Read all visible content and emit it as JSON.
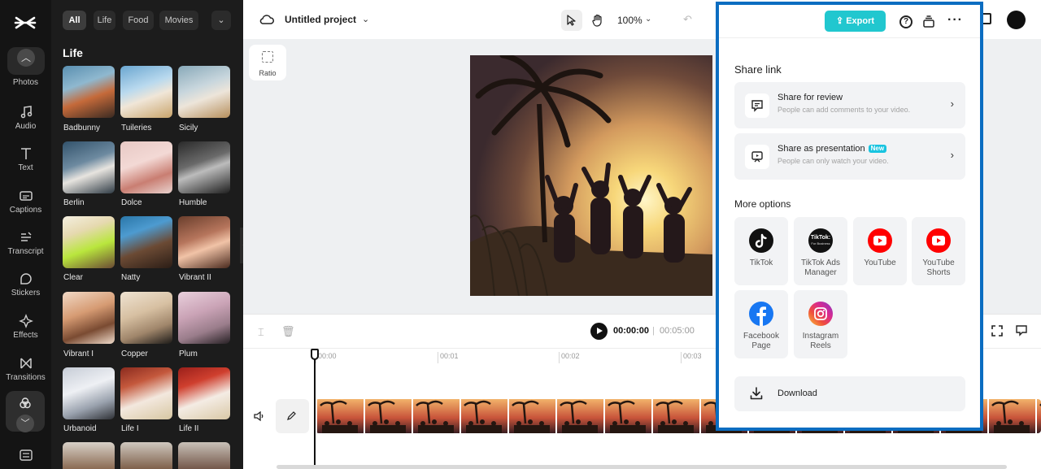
{
  "rail": {
    "items": [
      {
        "label": "Photos",
        "icon": "photo-icon"
      },
      {
        "label": "Audio",
        "icon": "music-note-icon"
      },
      {
        "label": "Text",
        "icon": "text-icon"
      },
      {
        "label": "Captions",
        "icon": "captions-icon"
      },
      {
        "label": "Transcript",
        "icon": "transcript-icon"
      },
      {
        "label": "Stickers",
        "icon": "sticker-icon"
      },
      {
        "label": "Effects",
        "icon": "effects-icon"
      },
      {
        "label": "Transitions",
        "icon": "transitions-icon"
      }
    ]
  },
  "panel": {
    "chips": [
      "All",
      "Life",
      "Food",
      "Movies"
    ],
    "heading": "Life",
    "filters": [
      "Badbunny",
      "Tuileries",
      "Sicily",
      "Berlin",
      "Dolce",
      "Humble",
      "Clear",
      "Natty",
      "Vibrant II",
      "Vibrant I",
      "Copper",
      "Plum",
      "Urbanoid",
      "Life I",
      "Life II"
    ]
  },
  "topbar": {
    "project_name": "Untitled project",
    "zoom": "100%"
  },
  "canvas": {
    "ratio_label": "Ratio"
  },
  "timeline": {
    "current_time": "00:00:00",
    "separator": "|",
    "duration": "00:05:00",
    "ruler": [
      "00:00",
      "00:01",
      "00:02",
      "00:03"
    ]
  },
  "share": {
    "export_label": "Export",
    "share_link_title": "Share link",
    "review": {
      "title": "Share for review",
      "subtitle": "People can add comments to your video."
    },
    "presentation": {
      "title": "Share as presentation",
      "badge": "New",
      "subtitle": "People can only watch your video."
    },
    "more_options_title": "More options",
    "options": [
      "TikTok",
      "TikTok Ads Manager",
      "YouTube",
      "YouTube Shorts",
      "Facebook Page",
      "Instagram Reels"
    ],
    "tiktok_ads_logo_text": "TikTok:",
    "tiktok_ads_logo_sub": "For Business",
    "download_label": "Download"
  },
  "colors": {
    "export_accent": "#21c7cf",
    "modal_border": "#0b6dc1",
    "youtube_red": "#ff0000",
    "facebook_blue": "#1877f2",
    "new_badge": "#18c4e0"
  }
}
